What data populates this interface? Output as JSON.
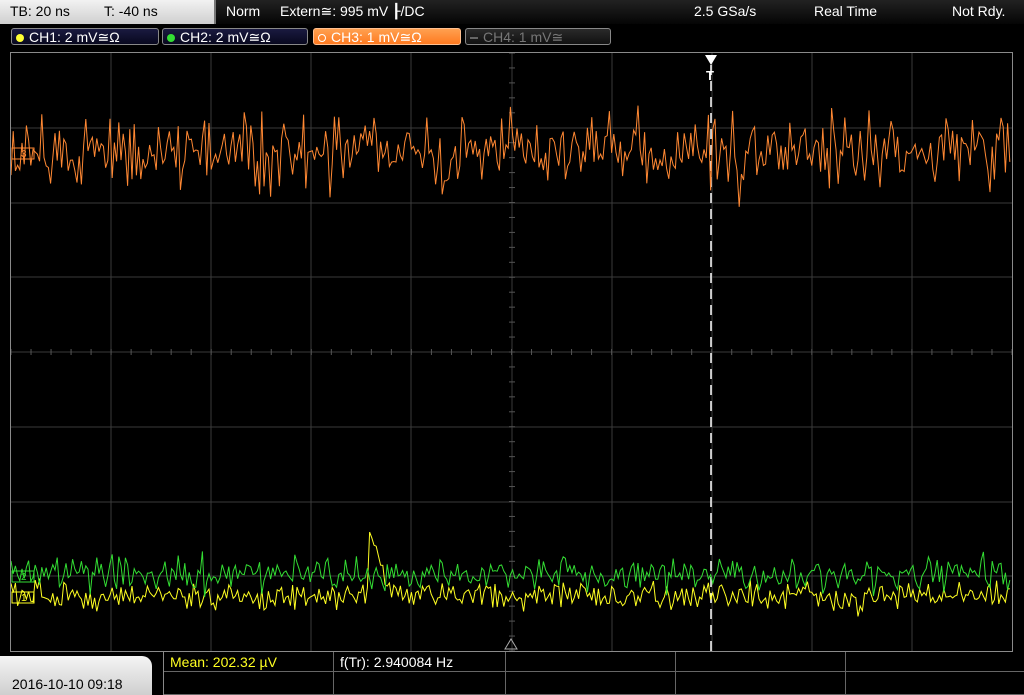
{
  "header": {
    "timebase": "TB: 20 ns",
    "trigger_time": "T: -40 ns",
    "mode": "Norm",
    "trigger_source": "Extern≅: 995 mV ┠/DC",
    "sample_rate": "2.5 GSa/s",
    "acq_mode": "Real Time",
    "status": "Not Rdy."
  },
  "channels": [
    {
      "label": "CH1: 2 mV≅Ω",
      "color": "#ffff33",
      "active": true
    },
    {
      "label": "CH2: 2 mV≅Ω",
      "color": "#33dd33",
      "active": true
    },
    {
      "label": "CH3: 1 mV≅Ω",
      "color": "#ff8a33",
      "active": true,
      "selected": true
    },
    {
      "label": "CH4: 1 mV≅",
      "color": "#777777",
      "active": false
    }
  ],
  "markers": {
    "trigger": "T",
    "ch3": "3",
    "ch2": "2",
    "ch1": "1"
  },
  "footer": {
    "datetime": "2016-10-10 09:18",
    "measurement_1": "Mean: 202.32 µV",
    "measurement_2": "f(Tr): 2.940084 Hz"
  },
  "colors": {
    "ch1": "#ffff22",
    "ch2": "#33dd33",
    "ch3": "#ff8833",
    "grid": "#3a3a3a",
    "accent": "#ff8a33"
  }
}
